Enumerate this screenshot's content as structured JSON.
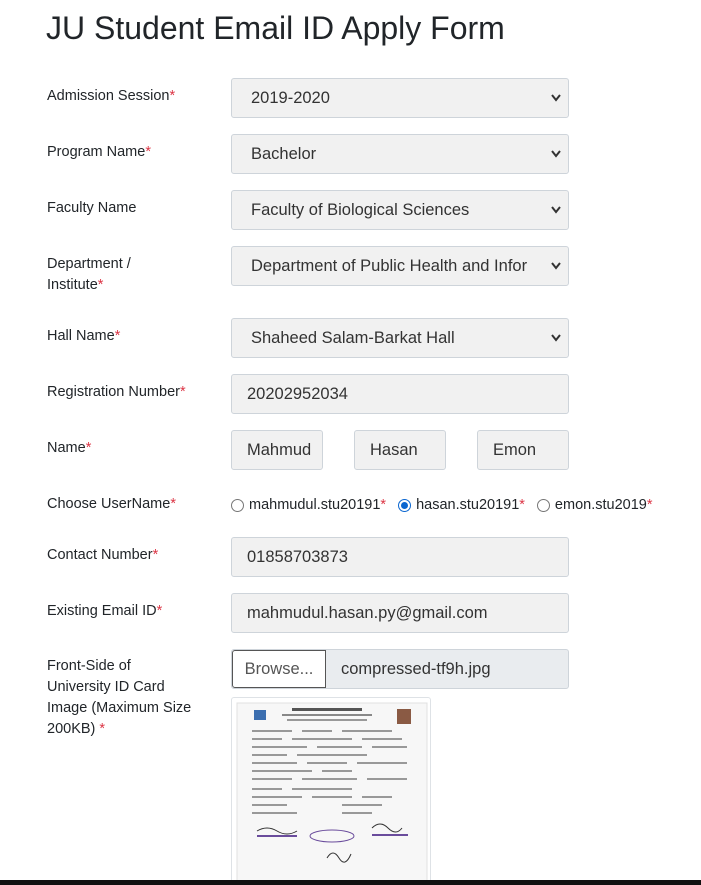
{
  "page": {
    "title": "JU Student Email ID Apply Form"
  },
  "form": {
    "admission_session": {
      "label": "Admission Session",
      "required": "*",
      "value": "2019-2020"
    },
    "program_name": {
      "label": "Program Name",
      "required": "*",
      "value": "Bachelor"
    },
    "faculty_name": {
      "label": "Faculty Name",
      "value": "Faculty of Biological Sciences"
    },
    "department": {
      "label_line1": "Department /",
      "label_line2": "Institute",
      "required": "*",
      "value": "Department of Public Health and Infor"
    },
    "hall_name": {
      "label": "Hall Name",
      "required": "*",
      "value": "Shaheed Salam-Barkat Hall"
    },
    "registration_number": {
      "label": "Registration Number",
      "required": "*",
      "value": "20202952034"
    },
    "name": {
      "label": "Name",
      "required": "*",
      "first": "Mahmud",
      "middle": "Hasan",
      "last": "Emon"
    },
    "username": {
      "label": "Choose UserName",
      "required": "*",
      "options": [
        {
          "text": "mahmudul.stu20191",
          "req": "*",
          "checked": false
        },
        {
          "text": "hasan.stu20191",
          "req": "*",
          "checked": true
        },
        {
          "text": "emon.stu2019",
          "req": "*",
          "checked": false
        }
      ]
    },
    "contact_number": {
      "label": "Contact Number",
      "required": "*",
      "value": "01858703873"
    },
    "existing_email": {
      "label": "Existing Email ID",
      "required": "*",
      "value": "mahmudul.hasan.py@gmail.com"
    },
    "id_card": {
      "label_line1": "Front-Side of",
      "label_line2": "University ID Card",
      "label_line3": "Image (Maximum Size",
      "label_line4": "200KB)",
      "required": "*",
      "browse_label": "Browse...",
      "file_name": "compressed-tf9h.jpg"
    }
  },
  "colors": {
    "required": "#dc3545",
    "radio_checked": "#0a66d0",
    "field_bg": "#f1f1f1"
  },
  "icons": {
    "select_arrow": "chevron-down-icon"
  }
}
